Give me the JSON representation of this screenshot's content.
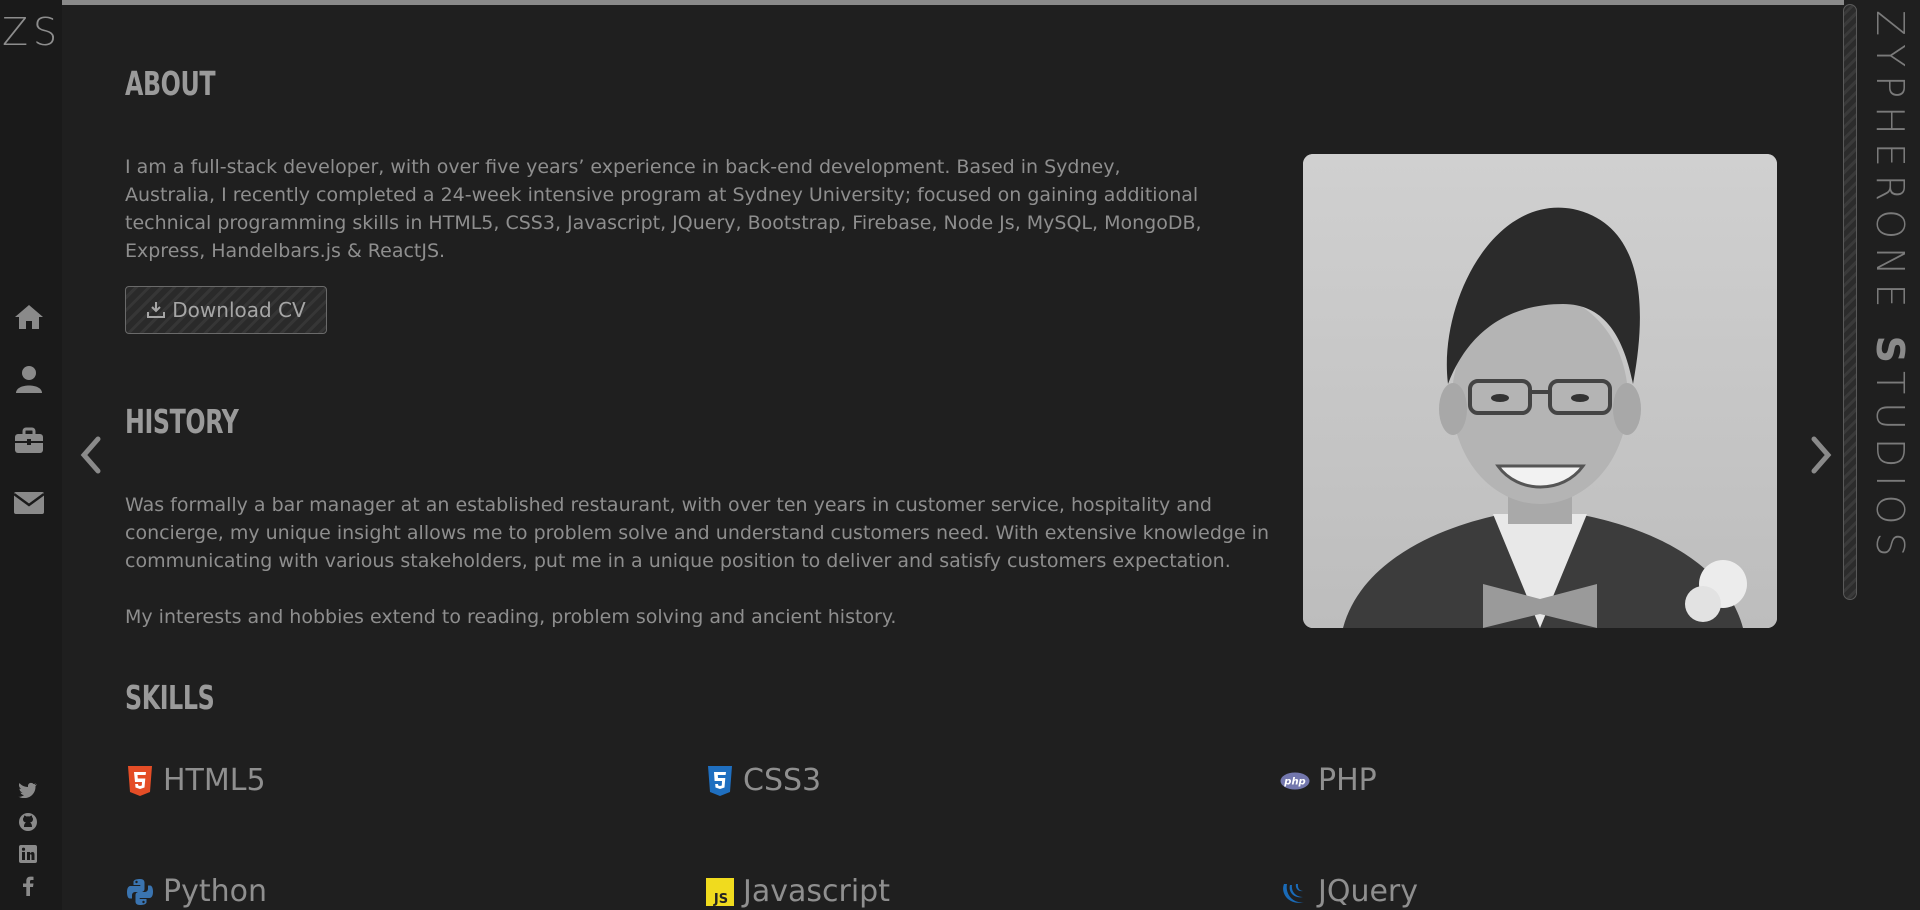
{
  "brand": {
    "logo": "ZS",
    "vertical_prefix": "ZYPHERONE",
    "vertical_bold": "S",
    "vertical_suffix": "TUDIOS"
  },
  "nav": {
    "items": [
      "home-icon",
      "user-icon",
      "briefcase-icon",
      "envelope-icon"
    ]
  },
  "social": {
    "items": [
      "twitter-icon",
      "github-icon",
      "linkedin-icon",
      "facebook-icon"
    ]
  },
  "about": {
    "heading": "ABOUT",
    "text": "I am a full-stack developer, with over five years’ experience in back-end development. Based in Sydney, Australia, I recently completed a 24-week intensive program at Sydney University; focused on gaining additional technical programming skills in HTML5, CSS3, Javascript, JQuery, Bootstrap, Firebase, Node Js, MySQL, MongoDB, Express, Handelbars.js & ReactJS.",
    "cv_button": "Download CV"
  },
  "history": {
    "heading": "HISTORY",
    "text1": "Was formally a bar manager at an established restaurant, with over ten years in customer service, hospitality and concierge, my unique insight allows me to problem solve and understand customers need. With extensive knowledge in communicating with various stakeholders, put me in a unique position to deliver and satisfy customers expectation.",
    "text2": "My interests and hobbies extend to reading, problem solving and ancient history."
  },
  "skills": {
    "heading": "SKILLS",
    "items": [
      {
        "label": "HTML5",
        "icon": "html5-icon",
        "color": "#e44d26"
      },
      {
        "label": "CSS3",
        "icon": "css3-icon",
        "color": "#1f6fc0"
      },
      {
        "label": "PHP",
        "icon": "php-icon",
        "color": "#7377ad"
      },
      {
        "label": "Python",
        "icon": "python-icon",
        "color": "#3a74b0"
      },
      {
        "label": "Javascript",
        "icon": "javascript-icon",
        "color": "#f0db1e"
      },
      {
        "label": "JQuery",
        "icon": "jquery-icon",
        "color": "#1a6bb8"
      }
    ]
  },
  "colors": {
    "background": "#1f1f1f",
    "rail": "#1a1a1a",
    "text": "#8e8e8e"
  }
}
